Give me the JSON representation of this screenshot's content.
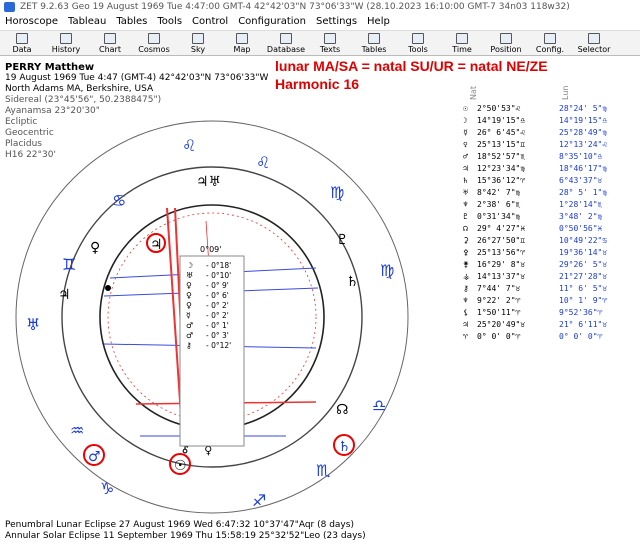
{
  "window": {
    "title": "ZET 9.2.63 Geo   19 August 1969  Tue   4:47:00 GMT-4 42°42'03\"N  73°06'33\"W   (28.10.2023  16:10:00 GMT-7 34n03 118w32)"
  },
  "menu": [
    "Horoscope",
    "Tableau",
    "Tables",
    "Tools",
    "Control",
    "Configuration",
    "Settings",
    "Help"
  ],
  "toolbar": [
    "Data",
    "History",
    "Chart",
    "Cosmos",
    "Sky",
    "Map",
    "Database",
    "Texts",
    "Tables",
    "Tools",
    "Time",
    "Position",
    "Config.",
    "Selector"
  ],
  "chart_info": {
    "name": "PERRY Matthew",
    "line1": "19 August 1969  Tue   4:47 (GMT-4) 42°42'03\"N  73°06'33\"W",
    "line2": "North Adams MA, Berkshire, USA",
    "line3": "Sidereal (23°45'56\", 50.2388475\")",
    "line4": "Ayanamsa 23°20'30\"",
    "line5": "Ecliptic",
    "line6": "Geocentric",
    "line7": "Placidus",
    "line8": "H16  22°30'"
  },
  "annotation": {
    "line1": "lunar MA/SA = natal SU/UR = natal NE/ZE",
    "line2": "Harmonic 16"
  },
  "center_box": {
    "top_label": "0°09'",
    "rows": [
      "- 0°18'",
      "- 0°10'",
      "- 0° 9'",
      "- 0° 6'",
      "- 0° 2'",
      "- 0° 2'",
      "- 0° 1'",
      "- 0° 3'",
      "- 0°12'"
    ]
  },
  "table_headers": {
    "natal": "Nat",
    "lunar": "Lun"
  },
  "table_rows": [
    {
      "g": "☉",
      "natal": "2°50'53\"♌",
      "lunar": "28°24' 5\"♍"
    },
    {
      "g": "☽",
      "natal": "14°19'15\"♎",
      "lunar": "14°19'15\"♎"
    },
    {
      "g": "☿",
      "natal": "26° 6'45\"♌",
      "lunar": "25°28'49\"♍"
    },
    {
      "g": "♀",
      "natal": "25°13'15\"♊",
      "lunar": "12°13'24\"♌"
    },
    {
      "g": "♂",
      "natal": "18°52'57\"♏",
      "lunar": "8°35'10\"♎"
    },
    {
      "g": "♃",
      "natal": "12°23'34\"♍",
      "lunar": "18°46'17\"♍"
    },
    {
      "g": "♄",
      "natal": "15°36'12\"♈",
      "lunar": "6°43'37\"♉"
    },
    {
      "g": "♅",
      "natal": "8°42' 7\"♍",
      "lunar": "28° 5' 1\"♍"
    },
    {
      "g": "♆",
      "natal": "2°38' 6\"♏",
      "lunar": "1°28'14\"♏"
    },
    {
      "g": "♇",
      "natal": "0°31'34\"♍",
      "lunar": "3°48' 2\"♍"
    },
    {
      "g": "☊",
      "natal": "29° 4'27\"♓",
      "lunar": "0°50'56\"♓"
    },
    {
      "g": "⚳",
      "natal": "26°27'50\"♊",
      "lunar": "10°49'22\"♋"
    },
    {
      "g": "⚴",
      "natal": "25°13'56\"♈",
      "lunar": "19°36'14\"♉"
    },
    {
      "g": "⚵",
      "natal": "16°29' 8\"♉",
      "lunar": "29°26' 5\"♉"
    },
    {
      "g": "⚶",
      "natal": "14°13'37\"♉",
      "lunar": "21°27'28\"♉"
    },
    {
      "g": "⚷",
      "natal": "7°44' 7\"♉",
      "lunar": "11° 6' 5\"♉"
    },
    {
      "g": "♆",
      "natal": "9°22' 2\"♈",
      "lunar": "10° 1' 9\"♈"
    },
    {
      "g": "⚸",
      "natal": "1°50'11\"♈",
      "lunar": "9°52'36\"♈"
    },
    {
      "g": "♃",
      "natal": "25°20'49\"♉",
      "lunar": "21° 6'11\"♉"
    },
    {
      "g": "♈",
      "natal": "0° 0' 0\"♈",
      "lunar": "0° 0' 0\"♈"
    }
  ],
  "footer": {
    "line1": "Penumbral Lunar Eclipse 27 August 1969 Wed  6:47:32 10°37'47\"Aqr (8 days)",
    "line2": "Annular Solar Eclipse 11 September 1969 Thu 15:58:19 25°32'52\"Leo (23 days)"
  }
}
